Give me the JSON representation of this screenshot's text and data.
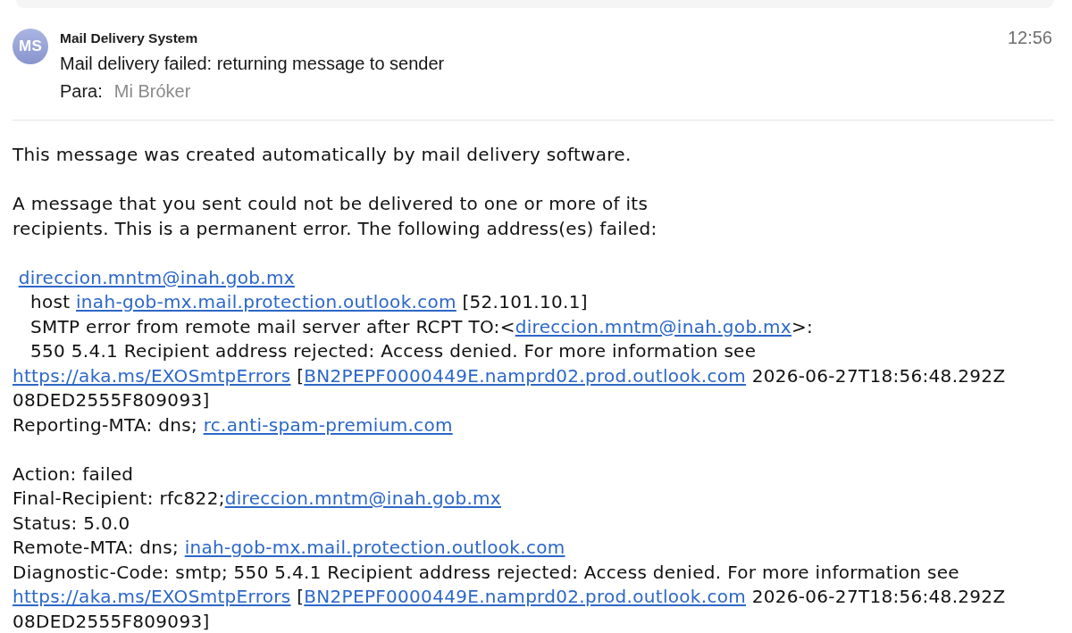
{
  "message": {
    "sender": {
      "initials": "MS",
      "name": "Mail Delivery System"
    },
    "time": "12:56",
    "subject": "Mail delivery failed: returning message to sender",
    "recipient": {
      "label": "Para:",
      "name": "Mi Bróker"
    }
  },
  "body": {
    "paragraphs": [
      {
        "lines": [
          [
            {
              "kind": "text",
              "text": "This message was created automatically by mail delivery software."
            }
          ]
        ]
      },
      {
        "lines": [
          [
            {
              "kind": "text",
              "text": "A message that you sent could not be delivered to one or more of its"
            }
          ],
          [
            {
              "kind": "text",
              "text": "recipients. This is a permanent error. The following address(es) failed:"
            }
          ]
        ]
      },
      {
        "lines": [
          [
            {
              "kind": "link",
              "text": " direccion.mntm@inah.gob.mx"
            }
          ],
          [
            {
              "kind": "text",
              "text": "   host "
            },
            {
              "kind": "link",
              "text": "inah-gob-mx.mail.protection.outlook.com"
            },
            {
              "kind": "text",
              "text": " [52.101.10.1]"
            }
          ],
          [
            {
              "kind": "text",
              "text": "   SMTP error from remote mail server after RCPT TO:<"
            },
            {
              "kind": "link",
              "text": "direccion.mntm@inah.gob.mx"
            },
            {
              "kind": "text",
              "text": ">:"
            }
          ],
          [
            {
              "kind": "text",
              "text": "   550 5.4.1 Recipient address rejected: Access denied. For more information see"
            }
          ],
          [
            {
              "kind": "link",
              "text": "https://aka.ms/EXOSmtpErrors"
            },
            {
              "kind": "text",
              "text": " ["
            },
            {
              "kind": "link",
              "text": "BN2PEPF0000449E.namprd02.prod.outlook.com"
            },
            {
              "kind": "text",
              "text": " 2026-06-27T18:56:48.292Z"
            }
          ],
          [
            {
              "kind": "text",
              "text": "08DED2555F809093]"
            }
          ],
          [
            {
              "kind": "text",
              "text": "Reporting-MTA: dns; "
            },
            {
              "kind": "link",
              "text": "rc.anti-spam-premium.com"
            }
          ]
        ]
      },
      {
        "lines": [
          [
            {
              "kind": "text",
              "text": "Action: failed"
            }
          ],
          [
            {
              "kind": "text",
              "text": "Final-Recipient: rfc822;"
            },
            {
              "kind": "link",
              "text": "direccion.mntm@inah.gob.mx"
            }
          ],
          [
            {
              "kind": "text",
              "text": "Status: 5.0.0"
            }
          ],
          [
            {
              "kind": "text",
              "text": "Remote-MTA: dns; "
            },
            {
              "kind": "link",
              "text": "inah-gob-mx.mail.protection.outlook.com"
            }
          ],
          [
            {
              "kind": "text",
              "text": "Diagnostic-Code: smtp; 550 5.4.1 Recipient address rejected: Access denied. For more information see"
            }
          ],
          [
            {
              "kind": "link",
              "text": "https://aka.ms/EXOSmtpErrors"
            },
            {
              "kind": "text",
              "text": " ["
            },
            {
              "kind": "link",
              "text": "BN2PEPF0000449E.namprd02.prod.outlook.com"
            },
            {
              "kind": "text",
              "text": " 2026-06-27T18:56:48.292Z"
            }
          ],
          [
            {
              "kind": "text",
              "text": "08DED2555F809093]"
            }
          ]
        ]
      }
    ]
  }
}
